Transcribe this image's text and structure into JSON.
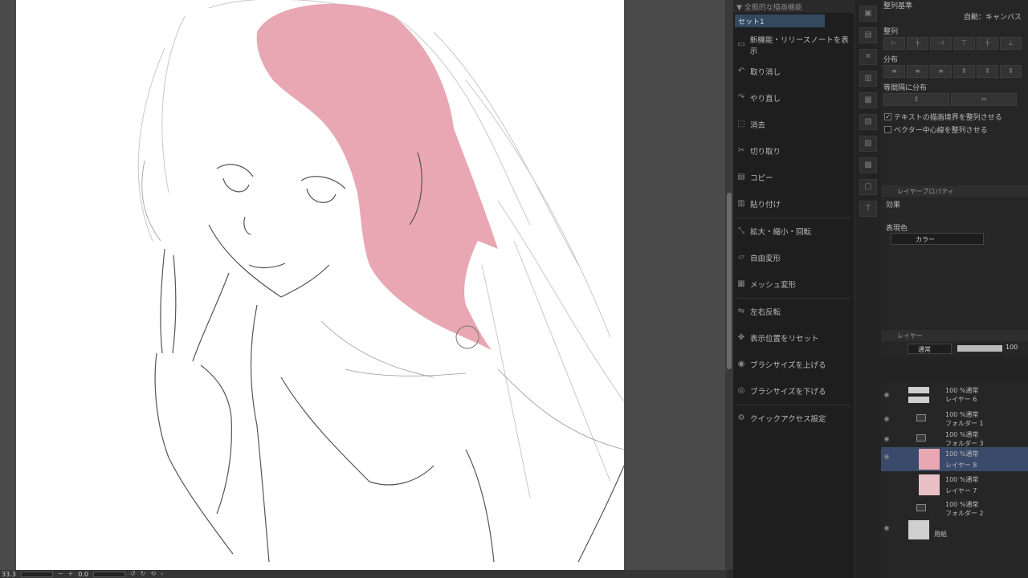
{
  "quick_access": {
    "header": "▼ 全般的な描画機能",
    "set_tab": "セット1",
    "items": [
      {
        "label": "新機能・リリースノートを表示",
        "icon": "info-icon"
      },
      {
        "label": "取り消し",
        "icon": "undo-icon"
      },
      {
        "label": "やり直し",
        "icon": "redo-icon"
      },
      {
        "label": "消去",
        "icon": "clear-icon"
      },
      {
        "label": "切り取り",
        "icon": "scissors-icon"
      },
      {
        "label": "コピー",
        "icon": "copy-icon"
      },
      {
        "label": "貼り付け",
        "icon": "paste-icon"
      },
      {
        "label": "拡大・縮小・回転",
        "icon": "transform-icon"
      },
      {
        "label": "自由変形",
        "icon": "free-transform-icon"
      },
      {
        "label": "メッシュ変形",
        "icon": "mesh-icon"
      },
      {
        "label": "左右反転",
        "icon": "flip-icon"
      },
      {
        "label": "表示位置をリセット",
        "icon": "reset-view-icon"
      },
      {
        "label": "ブラシサイズを上げる",
        "icon": "brush-up-icon"
      },
      {
        "label": "ブラシサイズを下げる",
        "icon": "brush-down-icon"
      },
      {
        "label": "クイックアクセス設定",
        "icon": "settings-icon"
      }
    ]
  },
  "align_panel": {
    "alignment_basis_label": "整列基準",
    "alignment_basis_value": "自動：キャンバス",
    "align_label": "整列",
    "distribute_label": "分布",
    "equal_spacing_label": "等間隔に分布",
    "check_text_bounds": {
      "label": "テキストの描画境界を整列させる",
      "checked": true
    },
    "check_vector_center": {
      "label": "ベクター中心線を整列させる",
      "checked": false
    }
  },
  "layer_property": {
    "title": "レイヤープロパティ",
    "effect_label": "効果",
    "display_color_label": "表現色",
    "display_color_value": "カラー"
  },
  "layer_panel": {
    "title": "レイヤー",
    "blend_mode": "通常",
    "opacity": "100",
    "layers": [
      {
        "line1": "100 %通常",
        "line2": "レイヤー 6",
        "type": "layer"
      },
      {
        "line1": "100 %通常",
        "line2": "フォルダー 1",
        "type": "folder"
      },
      {
        "line1": "100 %通常",
        "line2": "フォルダー 3",
        "type": "folder"
      },
      {
        "line1": "100 %通常",
        "line2": "レイヤー 8",
        "type": "layer",
        "selected": true
      },
      {
        "line1": "100 %通常",
        "line2": "レイヤー 7",
        "type": "layer"
      },
      {
        "line1": "100 %通常",
        "line2": "フォルダー 2",
        "type": "folder"
      },
      {
        "line1": "",
        "line2": "用紙",
        "type": "paper"
      }
    ]
  },
  "status": {
    "zoom": "33.3",
    "angle": "0.0"
  },
  "colors": {
    "hair_fill": "#e8a7b3",
    "selected_layer": "#3a4a6a"
  }
}
